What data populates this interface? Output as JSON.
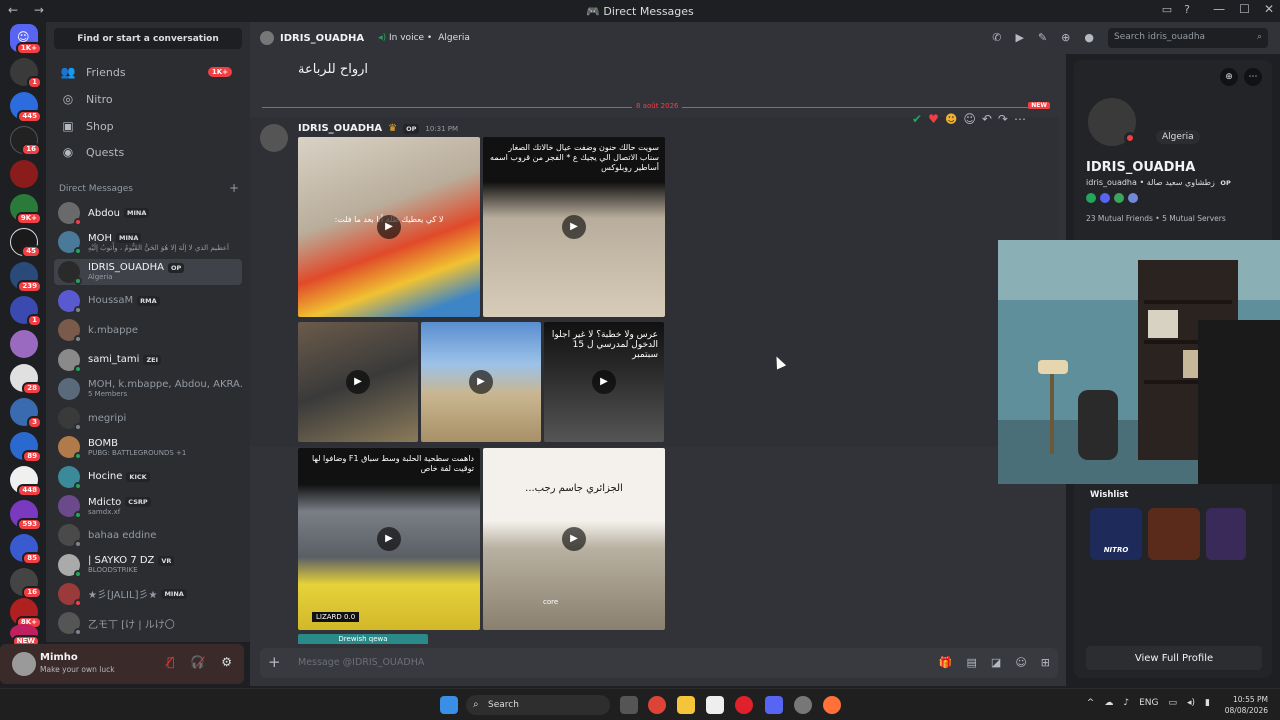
{
  "window": {
    "title": "Direct Messages",
    "nav": "← →"
  },
  "guild_badges": [
    "1K+",
    "1",
    "445",
    "16",
    "9K+",
    "45",
    "239",
    "1",
    "28",
    "3",
    "89",
    "448",
    "593",
    "85",
    "16",
    "8K+",
    "NEW"
  ],
  "sidebar": {
    "search_label": "Find or start a conversation",
    "nav": [
      {
        "label": "Friends",
        "icon": "friends-icon",
        "badge": "1K+"
      },
      {
        "label": "Nitro",
        "icon": "nitro-icon"
      },
      {
        "label": "Shop",
        "icon": "shop-icon"
      },
      {
        "label": "Quests",
        "icon": "quests-icon"
      }
    ],
    "dm_header": "Direct Messages",
    "dms": [
      {
        "name": "Abdou",
        "tag": "MINA",
        "sub": "",
        "status": "dnd"
      },
      {
        "name": "MOH",
        "tag": "MINA",
        "sub": "أعظيم الذي لا إلَهَ إلا هُوَ الحَيُّ القَيُّومُ ، وأَتوبُ إِلَيْهِ",
        "status": "on"
      },
      {
        "name": "IDRIS_OUADHA",
        "tag": "OP",
        "sub": "Algeria",
        "status": "on"
      },
      {
        "name": "HoussaM",
        "tag": "RMA",
        "sub": "",
        "status": "off"
      },
      {
        "name": "k.mbappe",
        "tag": "",
        "sub": "",
        "status": "off"
      },
      {
        "name": "sami_tami",
        "tag": "ZEI",
        "sub": "",
        "status": "on"
      },
      {
        "name": "MOH, k.mbappe, Abdou, AKRA...",
        "tag": "",
        "sub": "5 Members",
        "status": "none"
      },
      {
        "name": "megripi",
        "tag": "",
        "sub": "",
        "status": "off"
      },
      {
        "name": "BOMB",
        "tag": "",
        "sub": "PUBG: BATTLEGROUNDS +1",
        "status": "on"
      },
      {
        "name": "Hocine",
        "tag": "KICK",
        "sub": "",
        "status": "on"
      },
      {
        "name": "Mdicto",
        "tag": "CSRP",
        "sub": "samdx.xf",
        "status": "on"
      },
      {
        "name": "bahaa eddine",
        "tag": "",
        "sub": "",
        "status": "off"
      },
      {
        "name": "| SAYKO 7 DZ",
        "tag": "VR",
        "sub": "BLOODSTRIKE",
        "status": "on"
      },
      {
        "name": "★彡[JALIL]彡★",
        "tag": "MINA",
        "sub": "",
        "status": "dnd"
      },
      {
        "name": "乙モ丅 [け | ルけ〇",
        "tag": "",
        "sub": "",
        "status": "off"
      }
    ]
  },
  "user_panel": {
    "name": "Mimho",
    "status": "Make your own luck"
  },
  "chat": {
    "recipient": "IDRIS_OUADHA",
    "voice_label": "In voice",
    "country": "Algeria",
    "search_placeholder": "Search idris_ouadha",
    "previous_message": "ارواح للرباعة",
    "date_divider": "8 août 2026",
    "new_label": "NEW",
    "message": {
      "author": "IDRIS_OUADHA",
      "tag": "OP",
      "time": "10:31 PM"
    },
    "captions": {
      "v1": "لا كي يعطيك طلة أنا بعد ما فلت:",
      "v2": "سويت حالك حنون وضفت عيال خالاتك الصغار سناب الاتصال الي يجيك ع * الفجر من قروب اسمه أساطير روبلوكس",
      "v5": "عرس ولا خطبة؟ لا غير اجلوا الدخول لمدرسي ل 15 سبتمبر",
      "v6": "داهمت سطحية الحلبة وسط سباق F1 وضافوا لها توقيت لفة خاص",
      "v6b": "LIZARD 0.0",
      "v7": "الجزائري جاسم رجب...",
      "v7b": "core"
    },
    "mini_label": "Drewish qewa",
    "composer_placeholder": "Message @IDRIS_OUADHA"
  },
  "profile": {
    "display_name": "IDRIS_OUADHA",
    "username": "idris_ouadha",
    "pronouns": "زطشاوي سعيد صالة",
    "tag": "OP",
    "country": "Algeria",
    "mutual_friends": "23 Mutual Friends",
    "mutual_servers": "5 Mutual Servers",
    "wishlist_label": "Wishlist",
    "wishlist_item": "NITRO",
    "full_profile": "View Full Profile"
  },
  "taskbar": {
    "search": "Search",
    "lang": "ENG",
    "time": "10:55 PM",
    "date": "08/08/2026"
  }
}
